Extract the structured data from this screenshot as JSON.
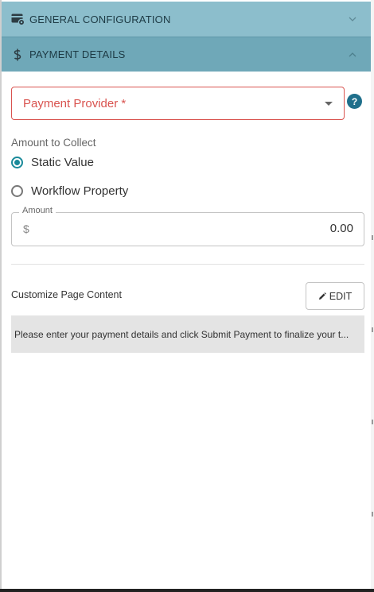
{
  "sections": {
    "general": {
      "title": "GENERAL CONFIGURATION",
      "icon": "payment-settings-icon"
    },
    "payment": {
      "title": "PAYMENT DETAILS",
      "icon": "dollar-icon"
    }
  },
  "provider_select": {
    "placeholder": "Payment Provider *"
  },
  "help_icon": {
    "glyph": "?"
  },
  "amount_to_collect": {
    "label": "Amount to Collect",
    "options": [
      {
        "label": "Static Value",
        "selected": true
      },
      {
        "label": "Workflow Property",
        "selected": false
      }
    ]
  },
  "amount_field": {
    "legend": "Amount",
    "prefix": "$",
    "value": "0.00"
  },
  "page_content": {
    "label": "Customize Page Content",
    "edit_label": "EDIT",
    "preview": "Please enter your payment details and click Submit Payment to finalize your t..."
  },
  "colors": {
    "general_header": "#8cbecc",
    "payment_header": "#6fa8b8",
    "error": "#d9534f",
    "accent": "#1a8a9a"
  }
}
